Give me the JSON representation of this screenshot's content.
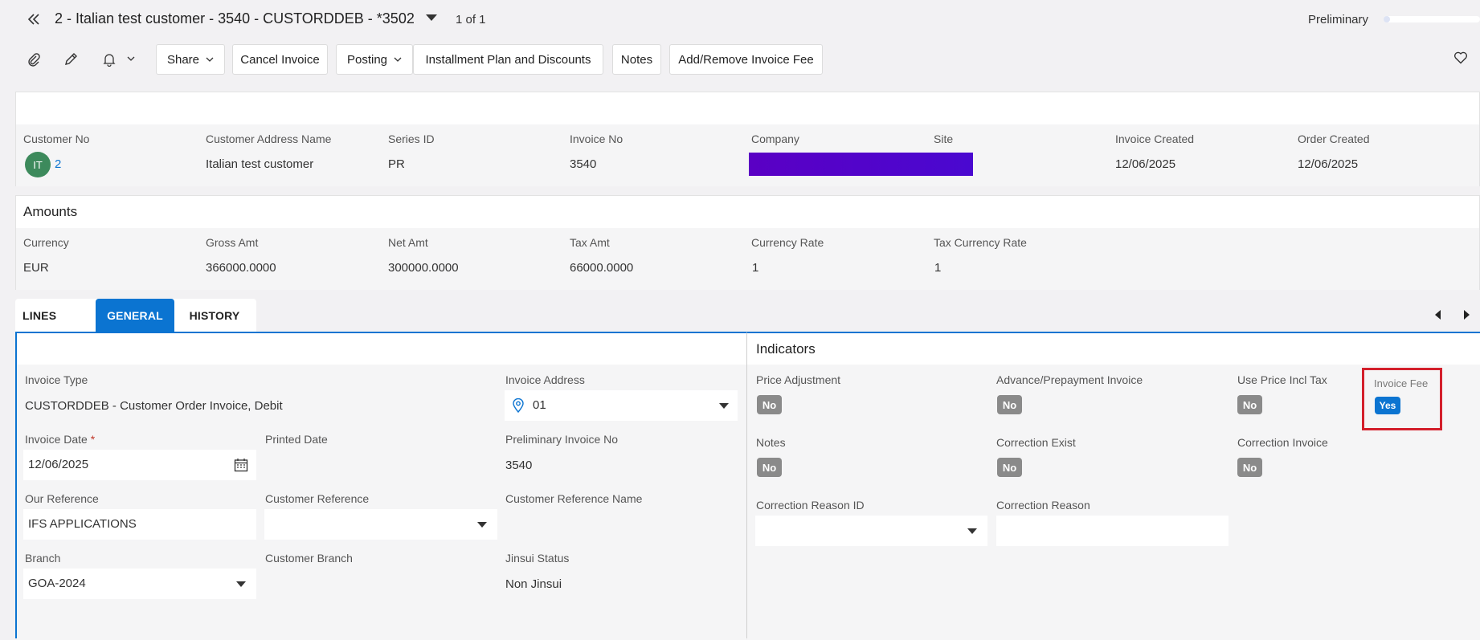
{
  "header": {
    "title": "2 - Italian test customer - 3540 - CUSTORDDEB - *3502",
    "record_count": "1 of 1",
    "status": "Preliminary",
    "status_progress": 0.02
  },
  "toolbar": {
    "share": "Share",
    "cancel_invoice": "Cancel Invoice",
    "posting": "Posting",
    "installment": "Installment Plan and Discounts",
    "notes": "Notes",
    "invoice_fee": "Add/Remove Invoice Fee"
  },
  "summary": {
    "customer_no_label": "Customer No",
    "customer_avatar": "IT",
    "customer_no": "2",
    "customer_address_name_label": "Customer Address Name",
    "customer_address_name": "Italian test customer",
    "series_id_label": "Series ID",
    "series_id": "PR",
    "invoice_no_label": "Invoice No",
    "invoice_no": "3540",
    "company_label": "Company",
    "site_label": "Site",
    "invoice_created_label": "Invoice Created",
    "invoice_created": "12/06/2025",
    "order_created_label": "Order Created",
    "order_created": "12/06/2025",
    "redaction_color": "#5200c8"
  },
  "amounts": {
    "title": "Amounts",
    "currency_label": "Currency",
    "currency": "EUR",
    "gross_label": "Gross Amt",
    "gross": "366000.0000",
    "net_label": "Net Amt",
    "net": "300000.0000",
    "tax_label": "Tax Amt",
    "tax": "66000.0000",
    "rate_label": "Currency Rate",
    "rate": "1",
    "tax_rate_label": "Tax Currency Rate",
    "tax_rate": "1"
  },
  "tabs": {
    "lines": "LINES",
    "general": "GENERAL",
    "history": "HISTORY"
  },
  "general": {
    "invoice_type_label": "Invoice Type",
    "invoice_type": "CUSTORDDEB - Customer Order Invoice, Debit",
    "invoice_address_label": "Invoice Address",
    "invoice_address": "01",
    "invoice_date_label": "Invoice Date",
    "required_mark": "*",
    "invoice_date": "12/06/2025",
    "printed_date_label": "Printed Date",
    "prelim_no_label": "Preliminary Invoice No",
    "prelim_no": "3540",
    "our_reference_label": "Our Reference",
    "our_reference": "IFS APPLICATIONS",
    "customer_reference_label": "Customer Reference",
    "customer_reference_name_label": "Customer Reference Name",
    "branch_label": "Branch",
    "branch": "GOA-2024",
    "customer_branch_label": "Customer Branch",
    "jinsui_label": "Jinsui Status",
    "jinsui": "Non Jinsui"
  },
  "indicators": {
    "title": "Indicators",
    "price_adjustment_label": "Price Adjustment",
    "price_adjustment": "No",
    "advance_label": "Advance/Prepayment Invoice",
    "advance": "No",
    "use_price_incl_tax_label": "Use Price Incl Tax",
    "use_price_incl_tax": "No",
    "invoice_fee_label": "Invoice Fee",
    "invoice_fee": "Yes",
    "notes_label": "Notes",
    "notes": "No",
    "correction_exist_label": "Correction Exist",
    "correction_exist": "No",
    "correction_invoice_label": "Correction Invoice",
    "correction_invoice": "No",
    "correction_reason_id_label": "Correction Reason ID",
    "correction_reason_label": "Correction Reason"
  },
  "colors": {
    "accent": "#0b74d1",
    "highlight": "#d31f2b",
    "avatar": "#3d8a5c",
    "badge_no": "#8a8a8a"
  }
}
